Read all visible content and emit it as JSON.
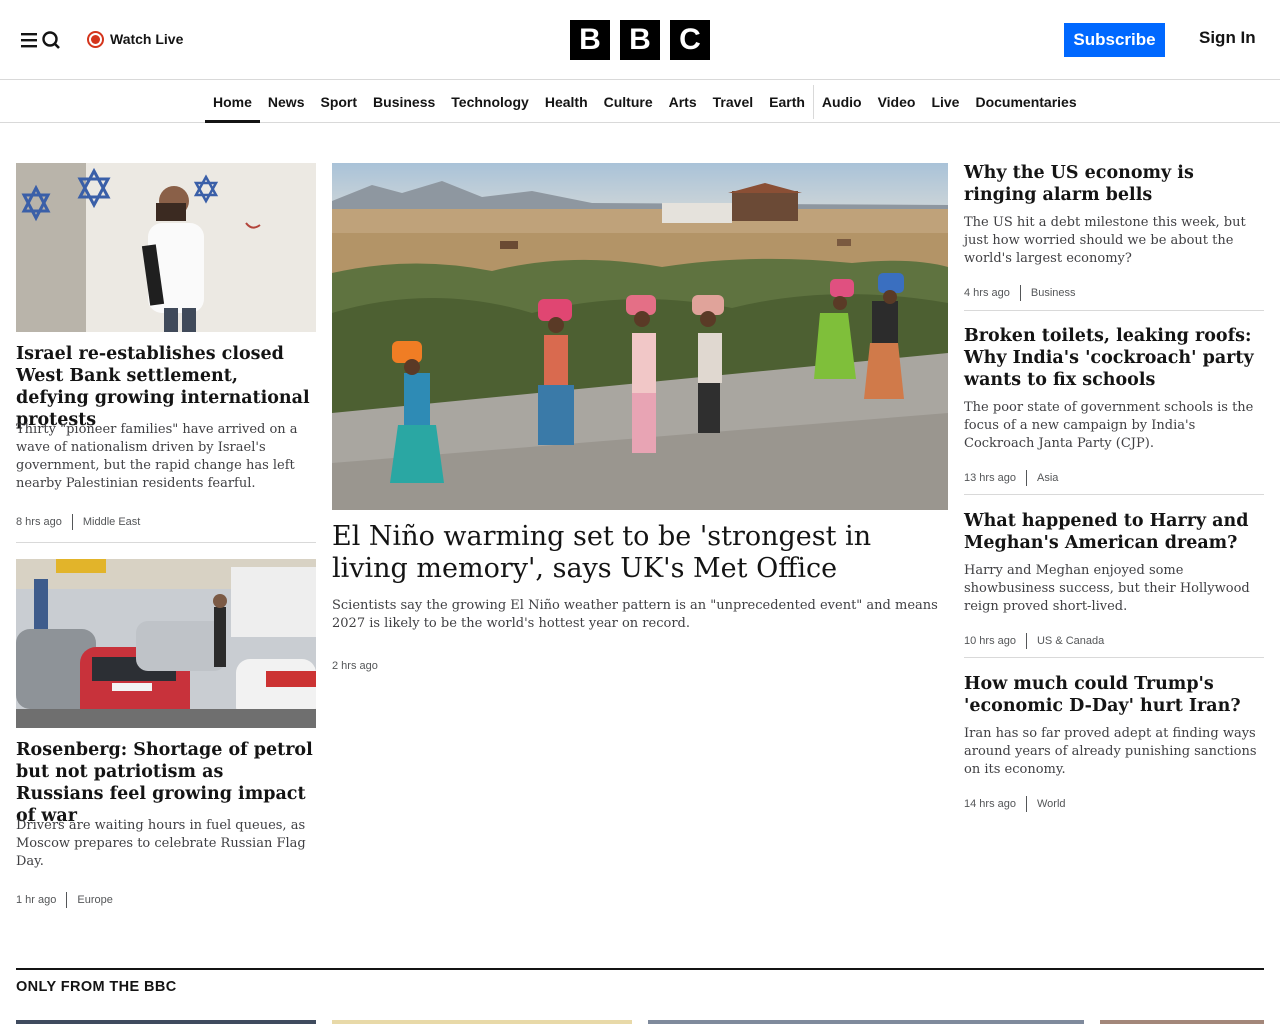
{
  "header": {
    "watch_live_label": "Watch Live",
    "logo_letters": [
      "B",
      "B",
      "C"
    ],
    "subscribe_label": "Subscribe",
    "signin_label": "Sign In",
    "accent_color": "#0068ff",
    "live_color": "#d4351c"
  },
  "nav": {
    "items": [
      {
        "label": "Home"
      },
      {
        "label": "News"
      },
      {
        "label": "Sport"
      },
      {
        "label": "Business"
      },
      {
        "label": "Technology"
      },
      {
        "label": "Health"
      },
      {
        "label": "Culture"
      },
      {
        "label": "Arts"
      },
      {
        "label": "Travel"
      },
      {
        "label": "Earth"
      },
      {
        "label": "Audio"
      },
      {
        "label": "Video"
      },
      {
        "label": "Live"
      },
      {
        "label": "Documentaries"
      }
    ],
    "active": "Home"
  },
  "left": [
    {
      "headline": "Israel re-establishes closed West Bank settlement, defying growing international protests",
      "summary": "Thirty \"pioneer families\" have arrived on a wave of nationalism driven by Israel's government, but the rapid change has left nearby Palestinian residents fearful.",
      "time": "8 hrs ago",
      "category": "Middle East"
    },
    {
      "headline": "Rosenberg: Shortage of petrol but not patriotism as Russians feel growing impact of war",
      "summary": "Drivers are waiting hours in fuel queues, as Moscow prepares to celebrate Russian Flag Day.",
      "time": "1 hr ago",
      "category": "Europe"
    }
  ],
  "center": {
    "headline": "El Niño warming set to be 'strongest in living memory', says UK's Met Office",
    "summary": "Scientists say the growing El Niño weather pattern is an \"unprecedented event\" and means 2027 is likely to be the world's hottest year on record.",
    "time": "2 hrs ago"
  },
  "right": [
    {
      "headline": "Why the US economy is ringing alarm bells",
      "summary": "The US hit a debt milestone this week, but just how worried should we be about the world's largest economy?",
      "time": "4 hrs ago",
      "category": "Business"
    },
    {
      "headline": "Broken toilets, leaking roofs: Why India's 'cockroach' party wants to fix schools",
      "summary": "The poor state of government schools is the focus of a new campaign by India's Cockroach Janta Party (CJP).",
      "time": "13 hrs ago",
      "category": "Asia"
    },
    {
      "headline": "What happened to Harry and Meghan's American dream?",
      "summary": "Harry and Meghan enjoyed some showbusiness success, but their Hollywood reign proved short-lived.",
      "time": "10 hrs ago",
      "category": "US & Canada"
    },
    {
      "headline": "How much could Trump's 'economic D-Day' hurt Iran?",
      "summary": "Iran has so far proved adept at finding ways around years of already punishing sanctions on its economy.",
      "time": "14 hrs ago",
      "category": "World"
    }
  ],
  "section": {
    "title": "ONLY FROM THE BBC"
  }
}
